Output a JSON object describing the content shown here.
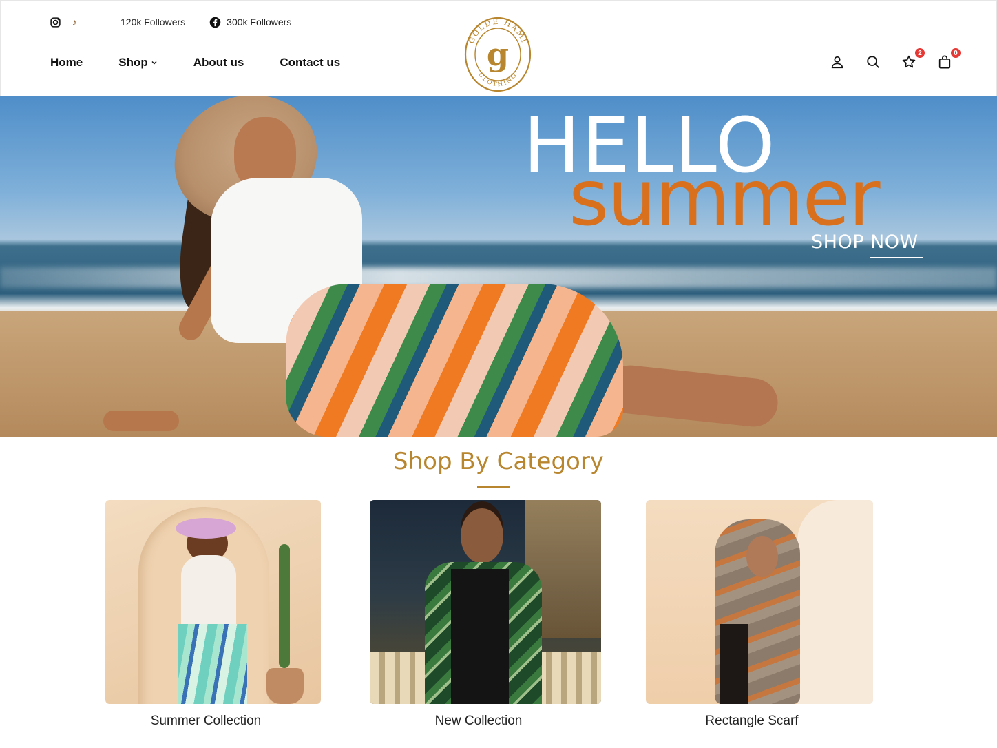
{
  "header": {
    "social": {
      "instagram_icon": "instagram-icon",
      "tiktok_icon": "tiktok-icon",
      "tiktok_glyph": "♪",
      "tiktok_followers": "120k Followers",
      "facebook_icon": "facebook-icon",
      "facebook_followers": "300k Followers"
    },
    "nav": {
      "home": "Home",
      "shop": "Shop",
      "about": "About us",
      "contact": "Contact us"
    },
    "logo": {
      "top_text": "GOLDE HAMI",
      "letter": "g",
      "bottom_text": "CLOTHING"
    },
    "actions": {
      "wishlist_count": "2",
      "cart_count": "0"
    }
  },
  "hero": {
    "line1": "HELLO",
    "line2": "summer",
    "cta": "SHOP NOW"
  },
  "categories": {
    "title": "Shop By Category",
    "items": [
      {
        "label": "Summer Collection"
      },
      {
        "label": "New Collection"
      },
      {
        "label": "Rectangle Scarf"
      }
    ]
  },
  "colors": {
    "accent_gold": "#b8862e",
    "hero_orange": "#d8701d",
    "badge_red": "#e53935"
  }
}
